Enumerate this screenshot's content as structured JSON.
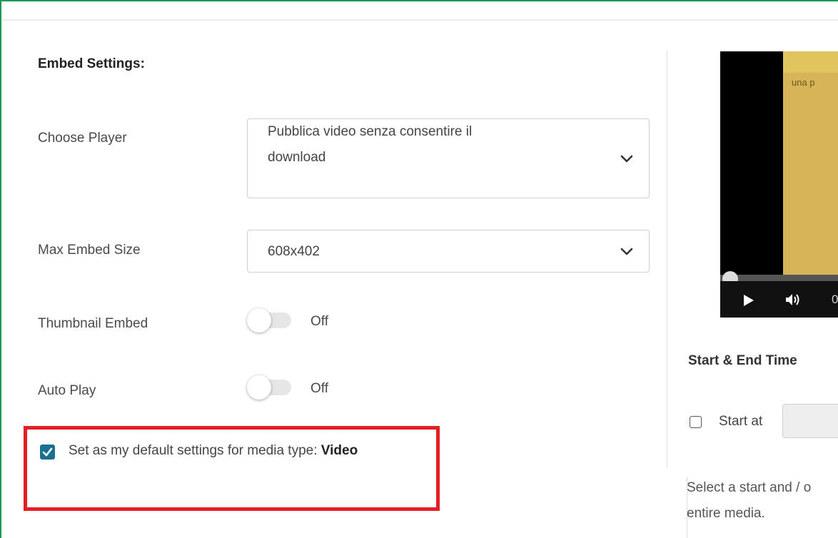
{
  "embed": {
    "title": "Embed Settings:",
    "choose_player": {
      "label": "Choose Player",
      "value_line1": "Pubblica video senza consentire il",
      "value_line2": "download"
    },
    "max_embed_size": {
      "label": "Max Embed Size",
      "value": "608x402"
    },
    "thumbnail_embed": {
      "label": "Thumbnail Embed",
      "state": "Off"
    },
    "auto_play": {
      "label": "Auto Play",
      "state": "Off"
    },
    "default_settings": {
      "label": "Set as my default settings for media type: ",
      "media_type": "Video",
      "checked": true
    }
  },
  "preview": {
    "video_caption": "una p",
    "time_fragment": "0",
    "progress": 0
  },
  "start_end": {
    "title": "Start & End Time",
    "start_label": "Start at",
    "start_value": "",
    "help_line1": "Select a start and / o",
    "help_line2": "entire media."
  },
  "colors": {
    "frame_border": "#1a9a54",
    "highlight_border": "#e31e24",
    "checkbox_checked": "#1a6e8e",
    "video_frame": "#d7b455"
  },
  "icons": {
    "select_arrow": "chevron-down-icon",
    "player_play": "play-icon",
    "player_volume": "volume-icon",
    "checked_box": "checkmark-icon"
  }
}
